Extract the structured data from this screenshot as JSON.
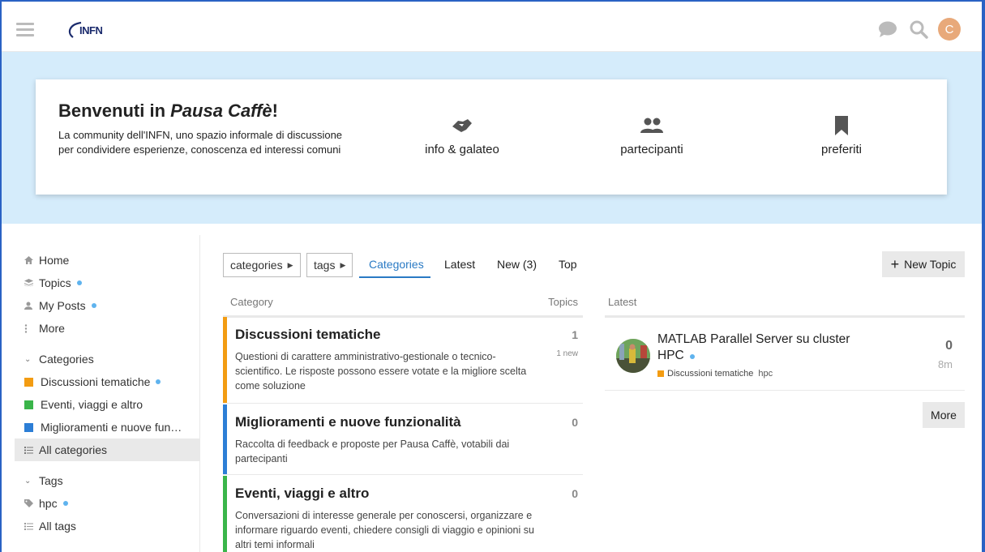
{
  "header": {
    "logo_text": "INFN",
    "icons": [
      "chat-icon",
      "search-icon"
    ],
    "avatar_letter": "C",
    "avatar_color": "#e8a97a"
  },
  "banner": {
    "title_prefix": "Benvenuti in ",
    "title_em": "Pausa Caffè",
    "title_suffix": "!",
    "description": "La community dell'INFN, uno spazio informale di discussione per condividere esperienze, conoscenza ed interessi comuni",
    "links": [
      {
        "label": "info & galateo",
        "icon": "handshake-icon"
      },
      {
        "label": "partecipanti",
        "icon": "users-icon"
      },
      {
        "label": "preferiti",
        "icon": "bookmark-icon"
      }
    ],
    "background": "#d5ecfb"
  },
  "sidebar": {
    "items": [
      {
        "label": "Home",
        "icon": "home-icon"
      },
      {
        "label": "Topics",
        "icon": "layers-icon",
        "unread": true
      },
      {
        "label": "My Posts",
        "icon": "user-icon",
        "unread": true
      },
      {
        "label": "More",
        "icon": "vertical-dots-icon"
      }
    ],
    "categories_label": "Categories",
    "categories": [
      {
        "label": "Discussioni tematiche",
        "color": "#f39c12",
        "unread": true
      },
      {
        "label": "Eventi, viaggi e altro",
        "color": "#3ab54a"
      },
      {
        "label": "Miglioramenti e nuove fun…",
        "color": "#2c7ed6"
      }
    ],
    "all_categories": "All categories",
    "tags_label": "Tags",
    "tags": [
      {
        "label": "hpc",
        "unread": true
      }
    ],
    "all_tags": "All tags"
  },
  "nav": {
    "dropdown_categories": "categories",
    "dropdown_tags": "tags",
    "tabs": [
      "Categories",
      "Latest",
      "New (3)",
      "Top"
    ],
    "active_tab": "Categories",
    "new_topic": "New Topic"
  },
  "categories_table": {
    "col_category": "Category",
    "col_topics": "Topics",
    "rows": [
      {
        "name": "Discussioni tematiche",
        "description": "Questioni di carattere amministrativo-gestionale o tecnico-scientifico. Le risposte possono essere votate e la migliore scelta come soluzione",
        "topics": "1",
        "new": "1 new",
        "color": "#f39c12"
      },
      {
        "name": "Miglioramenti e nuove funzionalità",
        "description": "Raccolta di feedback e proposte per Pausa Caffè, votabili dai partecipanti",
        "topics": "0",
        "new": "",
        "color": "#2c7ed6"
      },
      {
        "name": "Eventi, viaggi e altro",
        "description": "Conversazioni di interesse generale per conoscersi, organizzare e informare riguardo eventi, chiedere consigli di viaggio e opinioni su altri temi informali",
        "topics": "0",
        "new": "",
        "color": "#3ab54a"
      }
    ]
  },
  "latest": {
    "header": "Latest",
    "topics": [
      {
        "title": "MATLAB Parallel Server su cluster HPC",
        "category": "Discussioni tematiche",
        "category_color": "#f39c12",
        "tag": "hpc",
        "posts": "0",
        "age": "8m"
      }
    ],
    "more": "More"
  }
}
